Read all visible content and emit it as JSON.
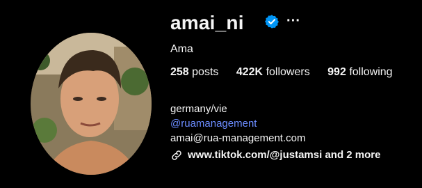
{
  "profile": {
    "username": "amai_ni",
    "more_glyph": "···",
    "full_name": "Ama",
    "stats": {
      "posts_count": "258",
      "posts_label": "posts",
      "followers_count": "422K",
      "followers_label": "followers",
      "following_count": "992",
      "following_label": "following"
    },
    "bio": {
      "location": "germany/vie",
      "mention": "@ruamanagement",
      "email": "amai@rua-management.com"
    },
    "links_text": "www.tiktok.com/@justamsi and 2 more"
  },
  "icons": {
    "verified": "verified-badge-icon",
    "link": "link-icon",
    "more": "more-options-icon"
  },
  "colors": {
    "background": "#000000",
    "text": "#f5f5f5",
    "verified_blue": "#0095f6",
    "mention_blue": "#6b8cff"
  }
}
